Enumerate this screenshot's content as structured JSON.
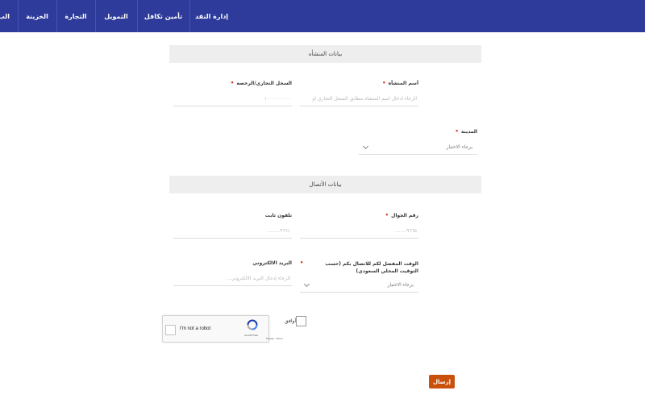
{
  "nav": {
    "items": [
      {
        "label": "إدارة النقد"
      },
      {
        "label": "تأمين تكافل"
      },
      {
        "label": "التمويل"
      },
      {
        "label": "التجارة"
      },
      {
        "label": "الخزينة"
      },
      {
        "label": "الب"
      }
    ]
  },
  "sections": {
    "establishment": "بيانات المنشأه",
    "contact": "بيانات الأتصال"
  },
  "fields": {
    "establishment_name": {
      "label": "أسم المنشأه",
      "placeholder": "الرجاء ادخال اسم المنشأه مطابق السجل التجاري او",
      "required": true
    },
    "commercial_register": {
      "label": "السجل التجاري/الرخصه",
      "placeholder": "١٠٠٠٠٠٠٠٠٠",
      "required": true
    },
    "city": {
      "label": "المدينة",
      "value": "يرجاء الاختيار",
      "required": true
    },
    "mobile": {
      "label": "رقم الجوال",
      "placeholder": "٩٦٦٥........",
      "required": true
    },
    "landline": {
      "label": "تلفون ثابت",
      "placeholder": "٩٦٦١........",
      "required": false
    },
    "preferred_time": {
      "label": "الوقت المفضل لكم للاتصال بكم (حسب التوقيت المحلي السعودي)",
      "value": "يرجاء الاختيار",
      "required": true
    },
    "email": {
      "label": "البريد الالكتروني",
      "placeholder": "الرجاء إدخال البريد الالكتروني...",
      "required": false
    }
  },
  "agree": {
    "label": "أوافق"
  },
  "recaptcha": {
    "text": "I'm not a robot",
    "brand": "reCAPTCHA",
    "terms": "Privacy - Terms"
  },
  "submit": {
    "label": "إرسال"
  },
  "colors": {
    "nav_bg": "#2e3b9a",
    "submit_bg": "#c9510c",
    "required_mark": "#d9342b"
  }
}
